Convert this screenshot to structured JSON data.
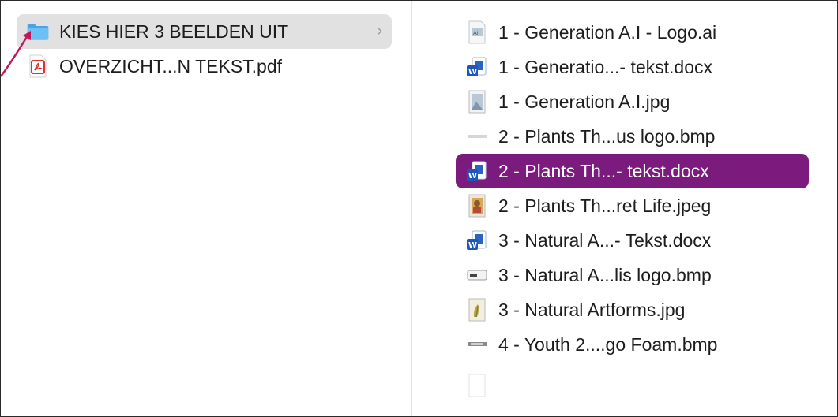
{
  "left_column": {
    "items": [
      {
        "label": "KIES HIER 3 BEELDEN UIT",
        "icon": "folder-icon",
        "chevron": "›",
        "selected": true
      },
      {
        "label": "OVERZICHT...N TEKST.pdf",
        "icon": "pdf-icon",
        "selected": false
      }
    ]
  },
  "right_column": {
    "items": [
      {
        "label": "1 - Generation A.I - Logo.ai",
        "icon": "ai-file-icon"
      },
      {
        "label": "1 - Generatio...- tekst.docx",
        "icon": "word-doc-icon"
      },
      {
        "label": "1 - Generation A.I.jpg",
        "icon": "image-file-icon"
      },
      {
        "label": "2 - Plants Th...us logo.bmp",
        "icon": "bmp-file-icon"
      },
      {
        "label": "2 - Plants Th...- tekst.docx",
        "icon": "word-doc-icon",
        "selected": true
      },
      {
        "label": "2 - Plants Th...ret Life.jpeg",
        "icon": "image-file-icon"
      },
      {
        "label": "3 - Natural A...- Tekst.docx",
        "icon": "word-doc-icon"
      },
      {
        "label": "3 - Natural A...lis logo.bmp",
        "icon": "bmp-file-icon"
      },
      {
        "label": "3 - Natural Artforms.jpg",
        "icon": "image-file-icon"
      },
      {
        "label": "4 - Youth 2....go Foam.bmp",
        "icon": "bmp-file-icon"
      }
    ]
  },
  "colors": {
    "selection": "#7b1b7e",
    "parent_selection": "#e1e1e1",
    "folder": "#5ab0ec",
    "arrow": "#c2185b"
  }
}
